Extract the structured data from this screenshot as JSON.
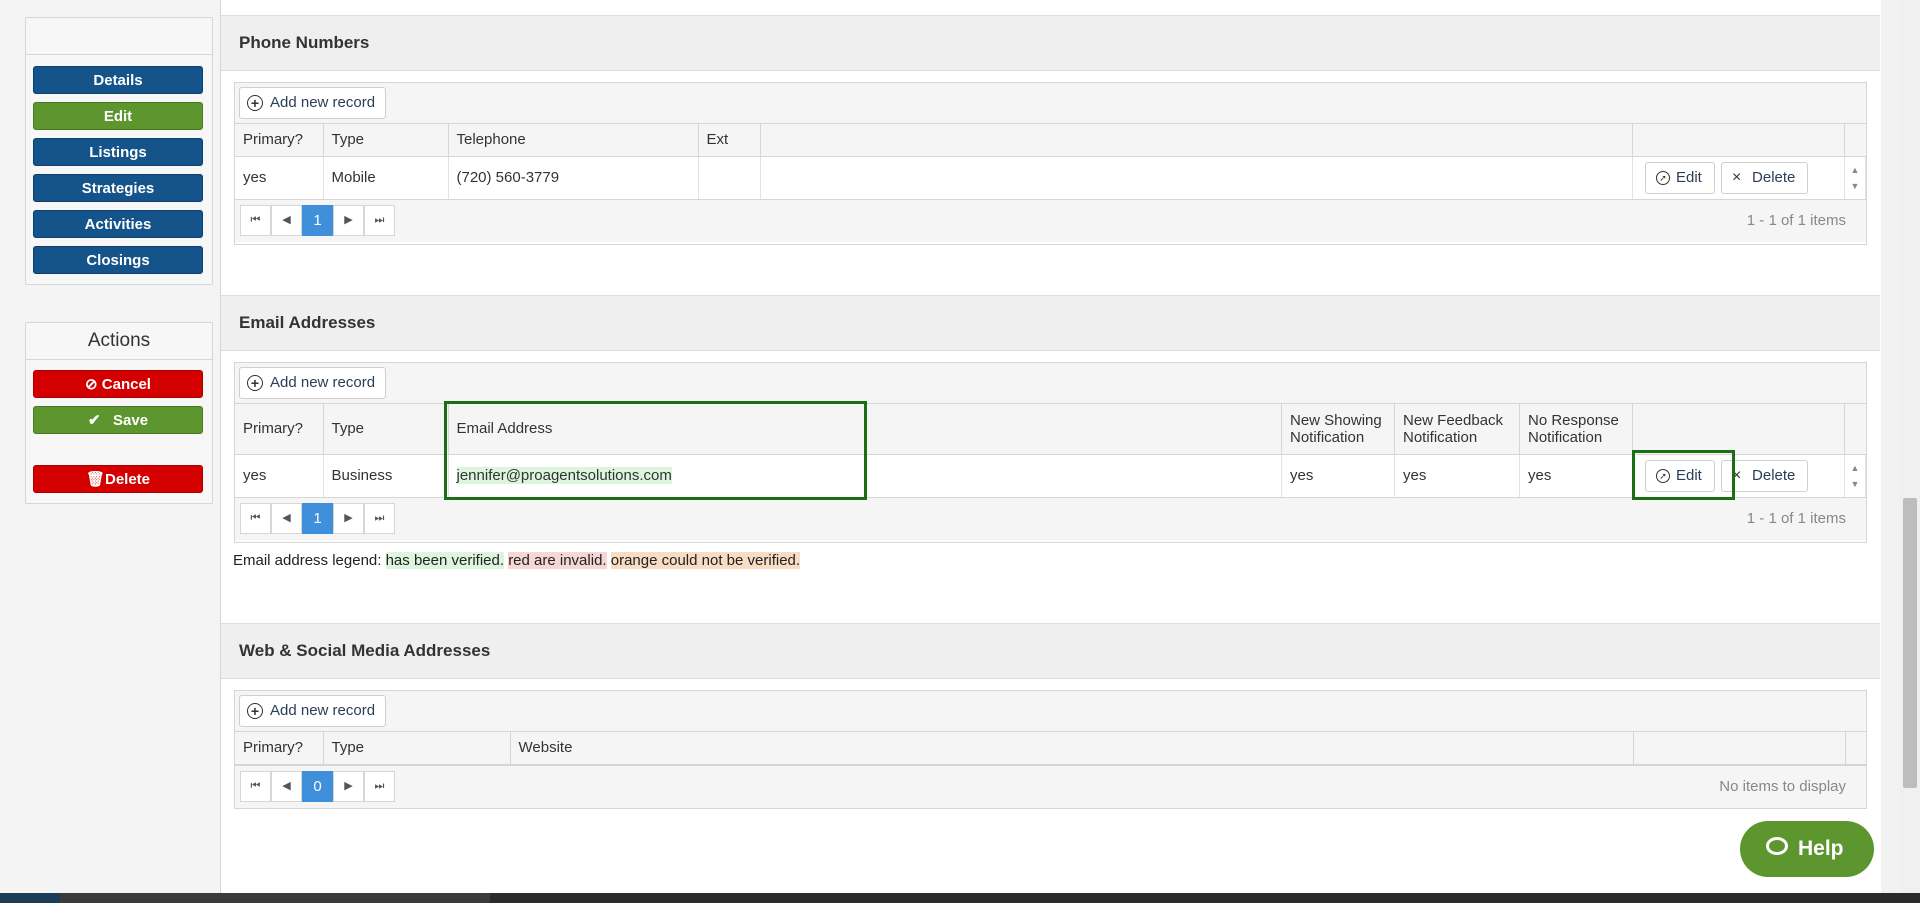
{
  "sidebar": {
    "nav": [
      {
        "label": "Details",
        "color": "#14548a"
      },
      {
        "label": "Edit",
        "color": "#5d962e"
      },
      {
        "label": "Listings",
        "color": "#14548a"
      },
      {
        "label": "Strategies",
        "color": "#14548a"
      },
      {
        "label": "Activities",
        "color": "#14548a"
      },
      {
        "label": "Closings",
        "color": "#14548a"
      }
    ],
    "actions_title": "Actions",
    "actions": {
      "cancel": "Cancel",
      "save": "Save",
      "delete": "Delete"
    }
  },
  "phones": {
    "title": "Phone Numbers",
    "add_label": "Add new record",
    "columns": [
      "Primary?",
      "Type",
      "Telephone",
      "Ext"
    ],
    "rows": [
      {
        "primary": "yes",
        "type": "Mobile",
        "telephone": "(720) 560-3779",
        "ext": ""
      }
    ],
    "edit_label": "Edit",
    "delete_label": "Delete",
    "page": "1",
    "info": "1 - 1 of 1 items"
  },
  "emails": {
    "title": "Email Addresses",
    "add_label": "Add new record",
    "columns": {
      "primary": "Primary?",
      "type": "Type",
      "email": "Email Address",
      "showing_1": "New Showing",
      "showing_2": "Notification",
      "feedback_1": "New Feedback",
      "feedback_2": "Notification",
      "noresp_1": "No Response",
      "noresp_2": "Notification"
    },
    "rows": [
      {
        "primary": "yes",
        "type": "Business",
        "email": "jennifer@proagentsolutions.com",
        "showing": "yes",
        "feedback": "yes",
        "noresp": "yes"
      }
    ],
    "edit_label": "Edit",
    "delete_label": "Delete",
    "page": "1",
    "info": "1 - 1 of 1 items"
  },
  "legend": {
    "prefix": "Email address legend:",
    "verified": "has been verified.",
    "invalid": "red are invalid.",
    "unverified": "orange could not be verified."
  },
  "web": {
    "title": "Web & Social Media Addresses",
    "add_label": "Add new record",
    "columns": [
      "Primary?",
      "Type",
      "Website"
    ],
    "page": "0",
    "info": "No items to display"
  },
  "help_label": "Help",
  "colors": {
    "primary_blue": "#14548a",
    "green": "#5d962e",
    "red": "#d40000",
    "highlight": "#1a6e14",
    "page_active": "#3f8fdb"
  }
}
